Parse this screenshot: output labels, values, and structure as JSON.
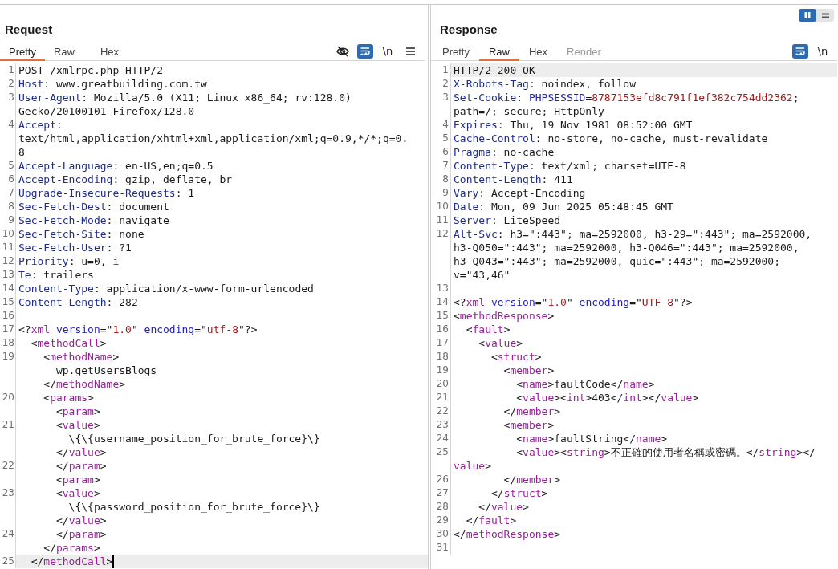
{
  "layout_toggle": [
    {
      "kind": "columns",
      "selected": true
    },
    {
      "kind": "rows",
      "selected": false
    }
  ],
  "request": {
    "title": "Request",
    "caret": true,
    "tabs": [
      {
        "label": "Pretty",
        "selected": true,
        "disabled": false
      },
      {
        "label": "Raw",
        "selected": false,
        "disabled": false
      },
      {
        "label": "Hex",
        "selected": false,
        "disabled": false
      }
    ],
    "toolbar": [
      {
        "kind": "hide",
        "on": false
      },
      {
        "kind": "wrap",
        "on": true
      },
      {
        "kind": "newline",
        "text": "\\n",
        "on": false
      },
      {
        "kind": "menu",
        "on": false
      }
    ],
    "lines": [
      {
        "number": "1",
        "highlighted": false,
        "rows": [
          {
            "tokens": [
              {
                "kind": "plain",
                "text": "POST /xmlrpc.php HTTP/2"
              }
            ]
          }
        ]
      },
      {
        "number": "2",
        "highlighted": false,
        "rows": [
          {
            "tokens": [
              {
                "kind": "header",
                "text": "Host"
              },
              {
                "kind": "plain",
                "text": ": www.greatbuilding.com.tw"
              }
            ]
          }
        ]
      },
      {
        "number": "3",
        "highlighted": false,
        "rows": [
          {
            "tokens": [
              {
                "kind": "header",
                "text": "User-Agent"
              },
              {
                "kind": "plain",
                "text": ": Mozilla/5.0 (X11; Linux x86_64; rv:128.0)"
              }
            ]
          },
          {
            "tokens": [
              {
                "kind": "plain",
                "text": "Gecko/20100101 Firefox/128.0"
              }
            ]
          }
        ]
      },
      {
        "number": "4",
        "highlighted": false,
        "rows": [
          {
            "tokens": [
              {
                "kind": "header",
                "text": "Accept"
              },
              {
                "kind": "plain",
                "text": ":"
              }
            ]
          },
          {
            "tokens": [
              {
                "kind": "plain",
                "text": "text/html,application/xhtml+xml,application/xml;q=0.9,*/*;q=0."
              }
            ]
          },
          {
            "tokens": [
              {
                "kind": "plain",
                "text": "8"
              }
            ]
          }
        ]
      },
      {
        "number": "5",
        "highlighted": false,
        "rows": [
          {
            "tokens": [
              {
                "kind": "header",
                "text": "Accept-Language"
              },
              {
                "kind": "plain",
                "text": ": en-US,en;q=0.5"
              }
            ]
          }
        ]
      },
      {
        "number": "6",
        "highlighted": false,
        "rows": [
          {
            "tokens": [
              {
                "kind": "header",
                "text": "Accept-Encoding"
              },
              {
                "kind": "plain",
                "text": ": gzip, deflate, br"
              }
            ]
          }
        ]
      },
      {
        "number": "7",
        "highlighted": false,
        "rows": [
          {
            "tokens": [
              {
                "kind": "header",
                "text": "Upgrade-Insecure-Requests"
              },
              {
                "kind": "plain",
                "text": ": 1"
              }
            ]
          }
        ]
      },
      {
        "number": "8",
        "highlighted": false,
        "rows": [
          {
            "tokens": [
              {
                "kind": "header",
                "text": "Sec-Fetch-Dest"
              },
              {
                "kind": "plain",
                "text": ": document"
              }
            ]
          }
        ]
      },
      {
        "number": "9",
        "highlighted": false,
        "rows": [
          {
            "tokens": [
              {
                "kind": "header",
                "text": "Sec-Fetch-Mode"
              },
              {
                "kind": "plain",
                "text": ": navigate"
              }
            ]
          }
        ]
      },
      {
        "number": "10",
        "highlighted": false,
        "rows": [
          {
            "tokens": [
              {
                "kind": "header",
                "text": "Sec-Fetch-Site"
              },
              {
                "kind": "plain",
                "text": ": none"
              }
            ]
          }
        ]
      },
      {
        "number": "11",
        "highlighted": false,
        "rows": [
          {
            "tokens": [
              {
                "kind": "header",
                "text": "Sec-Fetch-User"
              },
              {
                "kind": "plain",
                "text": ": ?1"
              }
            ]
          }
        ]
      },
      {
        "number": "12",
        "highlighted": false,
        "rows": [
          {
            "tokens": [
              {
                "kind": "header",
                "text": "Priority"
              },
              {
                "kind": "plain",
                "text": ": u=0, i"
              }
            ]
          }
        ]
      },
      {
        "number": "13",
        "highlighted": false,
        "rows": [
          {
            "tokens": [
              {
                "kind": "header",
                "text": "Te"
              },
              {
                "kind": "plain",
                "text": ": trailers"
              }
            ]
          }
        ]
      },
      {
        "number": "14",
        "highlighted": false,
        "rows": [
          {
            "tokens": [
              {
                "kind": "header",
                "text": "Content-Type"
              },
              {
                "kind": "plain",
                "text": ": application/x-www-form-urlencoded"
              }
            ]
          }
        ]
      },
      {
        "number": "15",
        "highlighted": false,
        "rows": [
          {
            "tokens": [
              {
                "kind": "header",
                "text": "Content-Length"
              },
              {
                "kind": "plain",
                "text": ": 282"
              }
            ]
          }
        ]
      },
      {
        "number": "16",
        "highlighted": false
      },
      {
        "number": "17",
        "highlighted": false,
        "rows": [
          {
            "tokens": [
              {
                "kind": "plain",
                "text": "<?"
              },
              {
                "kind": "tag",
                "text": "xml"
              },
              {
                "kind": "attr",
                "text": " version"
              },
              {
                "kind": "plain",
                "text": "=\""
              },
              {
                "kind": "value",
                "text": "1.0"
              },
              {
                "kind": "plain",
                "text": "\" "
              },
              {
                "kind": "attr",
                "text": "encoding"
              },
              {
                "kind": "plain",
                "text": "=\""
              },
              {
                "kind": "value",
                "text": "utf-8"
              },
              {
                "kind": "plain",
                "text": "\"?>"
              }
            ]
          }
        ]
      },
      {
        "number": "18",
        "highlighted": false,
        "rows": [
          {
            "tokens": [
              {
                "kind": "plain",
                "text": "  <"
              },
              {
                "kind": "tag",
                "text": "methodCall"
              },
              {
                "kind": "plain",
                "text": ">"
              }
            ]
          }
        ]
      },
      {
        "number": "19",
        "highlighted": false,
        "rows": [
          {
            "tokens": [
              {
                "kind": "plain",
                "text": "    <"
              },
              {
                "kind": "tag",
                "text": "methodName"
              },
              {
                "kind": "plain",
                "text": ">"
              }
            ]
          },
          {
            "tokens": [
              {
                "kind": "plain",
                "text": "      wp.getUsersBlogs"
              }
            ]
          },
          {
            "tokens": [
              {
                "kind": "plain",
                "text": "    </"
              },
              {
                "kind": "tag",
                "text": "methodName"
              },
              {
                "kind": "plain",
                "text": ">"
              }
            ]
          }
        ]
      },
      {
        "number": "20",
        "highlighted": false,
        "rows": [
          {
            "tokens": [
              {
                "kind": "plain",
                "text": "    <"
              },
              {
                "kind": "tag",
                "text": "params"
              },
              {
                "kind": "plain",
                "text": ">"
              }
            ]
          },
          {
            "tokens": [
              {
                "kind": "plain",
                "text": "      <"
              },
              {
                "kind": "tag",
                "text": "param"
              },
              {
                "kind": "plain",
                "text": ">"
              }
            ]
          }
        ]
      },
      {
        "number": "21",
        "highlighted": false,
        "rows": [
          {
            "tokens": [
              {
                "kind": "plain",
                "text": "      <"
              },
              {
                "kind": "tag",
                "text": "value"
              },
              {
                "kind": "plain",
                "text": ">"
              }
            ]
          },
          {
            "tokens": [
              {
                "kind": "plain",
                "text": "        \\{\\{username_position_for_brute_force}\\}"
              }
            ]
          },
          {
            "tokens": [
              {
                "kind": "plain",
                "text": "      </"
              },
              {
                "kind": "tag",
                "text": "value"
              },
              {
                "kind": "plain",
                "text": ">"
              }
            ]
          }
        ]
      },
      {
        "number": "22",
        "highlighted": false,
        "rows": [
          {
            "tokens": [
              {
                "kind": "plain",
                "text": "      </"
              },
              {
                "kind": "tag",
                "text": "param"
              },
              {
                "kind": "plain",
                "text": ">"
              }
            ]
          },
          {
            "tokens": [
              {
                "kind": "plain",
                "text": "      <"
              },
              {
                "kind": "tag",
                "text": "param"
              },
              {
                "kind": "plain",
                "text": ">"
              }
            ]
          }
        ]
      },
      {
        "number": "23",
        "highlighted": false,
        "rows": [
          {
            "tokens": [
              {
                "kind": "plain",
                "text": "      <"
              },
              {
                "kind": "tag",
                "text": "value"
              },
              {
                "kind": "plain",
                "text": ">"
              }
            ]
          },
          {
            "tokens": [
              {
                "kind": "plain",
                "text": "        \\{\\{password_position_for_brute_force}\\}"
              }
            ]
          },
          {
            "tokens": [
              {
                "kind": "plain",
                "text": "      </"
              },
              {
                "kind": "tag",
                "text": "value"
              },
              {
                "kind": "plain",
                "text": ">"
              }
            ]
          }
        ]
      },
      {
        "number": "24",
        "highlighted": false,
        "rows": [
          {
            "tokens": [
              {
                "kind": "plain",
                "text": "      </"
              },
              {
                "kind": "tag",
                "text": "param"
              },
              {
                "kind": "plain",
                "text": ">"
              }
            ]
          },
          {
            "tokens": [
              {
                "kind": "plain",
                "text": "    </"
              },
              {
                "kind": "tag",
                "text": "params"
              },
              {
                "kind": "plain",
                "text": ">"
              }
            ]
          }
        ]
      },
      {
        "number": "25",
        "highlighted": true,
        "rows": [
          {
            "tokens": [
              {
                "kind": "plain",
                "text": "  </"
              },
              {
                "kind": "tag",
                "text": "methodCall"
              },
              {
                "kind": "plain",
                "text": ">"
              }
            ]
          }
        ]
      }
    ]
  },
  "response": {
    "title": "Response",
    "tabs": [
      {
        "label": "Pretty",
        "selected": false,
        "disabled": false
      },
      {
        "label": "Raw",
        "selected": true,
        "disabled": false
      },
      {
        "label": "Hex",
        "selected": false,
        "disabled": false
      },
      {
        "label": "Render",
        "selected": false,
        "disabled": true
      }
    ],
    "toolbar": [
      {
        "kind": "wrap",
        "on": true
      },
      {
        "kind": "newline",
        "text": "\\n",
        "on": false
      }
    ],
    "lines": [
      {
        "number": "1",
        "highlighted": true,
        "rows": [
          {
            "tokens": [
              {
                "kind": "plain",
                "text": "HTTP/2 200 OK"
              }
            ]
          }
        ]
      },
      {
        "number": "2",
        "highlighted": false,
        "rows": [
          {
            "tokens": [
              {
                "kind": "header",
                "text": "X-Robots-Tag"
              },
              {
                "kind": "plain",
                "text": ": noindex, follow"
              }
            ]
          }
        ]
      },
      {
        "number": "3",
        "highlighted": false,
        "rows": [
          {
            "tokens": [
              {
                "kind": "header",
                "text": "Set-Cookie"
              },
              {
                "kind": "plain",
                "text": ": "
              },
              {
                "kind": "attr",
                "text": "PHPSESSID"
              },
              {
                "kind": "plain",
                "text": "="
              },
              {
                "kind": "value",
                "text": "8787153efd8c791f1ef382c754dd2362"
              },
              {
                "kind": "plain",
                "text": ";"
              }
            ]
          },
          {
            "tokens": [
              {
                "kind": "plain",
                "text": "path=/; secure; HttpOnly"
              }
            ]
          }
        ]
      },
      {
        "number": "4",
        "highlighted": false,
        "rows": [
          {
            "tokens": [
              {
                "kind": "header",
                "text": "Expires"
              },
              {
                "kind": "plain",
                "text": ": Thu, 19 Nov 1981 08:52:00 GMT"
              }
            ]
          }
        ]
      },
      {
        "number": "5",
        "highlighted": false,
        "rows": [
          {
            "tokens": [
              {
                "kind": "header",
                "text": "Cache-Control"
              },
              {
                "kind": "plain",
                "text": ": no-store, no-cache, must-revalidate"
              }
            ]
          }
        ]
      },
      {
        "number": "6",
        "highlighted": false,
        "rows": [
          {
            "tokens": [
              {
                "kind": "header",
                "text": "Pragma"
              },
              {
                "kind": "plain",
                "text": ": no-cache"
              }
            ]
          }
        ]
      },
      {
        "number": "7",
        "highlighted": false,
        "rows": [
          {
            "tokens": [
              {
                "kind": "header",
                "text": "Content-Type"
              },
              {
                "kind": "plain",
                "text": ": text/xml; charset=UTF-8"
              }
            ]
          }
        ]
      },
      {
        "number": "8",
        "highlighted": false,
        "rows": [
          {
            "tokens": [
              {
                "kind": "header",
                "text": "Content-Length"
              },
              {
                "kind": "plain",
                "text": ": 411"
              }
            ]
          }
        ]
      },
      {
        "number": "9",
        "highlighted": false,
        "rows": [
          {
            "tokens": [
              {
                "kind": "header",
                "text": "Vary"
              },
              {
                "kind": "plain",
                "text": ": Accept-Encoding"
              }
            ]
          }
        ]
      },
      {
        "number": "10",
        "highlighted": false,
        "rows": [
          {
            "tokens": [
              {
                "kind": "header",
                "text": "Date"
              },
              {
                "kind": "plain",
                "text": ": Mon, 09 Jun 2025 05:48:45 GMT"
              }
            ]
          }
        ]
      },
      {
        "number": "11",
        "highlighted": false,
        "rows": [
          {
            "tokens": [
              {
                "kind": "header",
                "text": "Server"
              },
              {
                "kind": "plain",
                "text": ": LiteSpeed"
              }
            ]
          }
        ]
      },
      {
        "number": "12",
        "highlighted": false,
        "rows": [
          {
            "tokens": [
              {
                "kind": "header",
                "text": "Alt-Svc"
              },
              {
                "kind": "plain",
                "text": ": h3=\":443\"; ma=2592000, h3-29=\":443\"; ma=2592000,"
              }
            ]
          },
          {
            "tokens": [
              {
                "kind": "plain",
                "text": "h3-Q050=\":443\"; ma=2592000, h3-Q046=\":443\"; ma=2592000,"
              }
            ]
          },
          {
            "tokens": [
              {
                "kind": "plain",
                "text": "h3-Q043=\":443\"; ma=2592000, quic=\":443\"; ma=2592000;"
              }
            ]
          },
          {
            "tokens": [
              {
                "kind": "plain",
                "text": "v=\"43,46\""
              }
            ]
          }
        ]
      },
      {
        "number": "13",
        "highlighted": false
      },
      {
        "number": "14",
        "highlighted": false,
        "rows": [
          {
            "tokens": [
              {
                "kind": "plain",
                "text": "<?"
              },
              {
                "kind": "tag",
                "text": "xml"
              },
              {
                "kind": "attr",
                "text": " version"
              },
              {
                "kind": "plain",
                "text": "=\""
              },
              {
                "kind": "value",
                "text": "1.0"
              },
              {
                "kind": "plain",
                "text": "\" "
              },
              {
                "kind": "attr",
                "text": "encoding"
              },
              {
                "kind": "plain",
                "text": "=\""
              },
              {
                "kind": "value",
                "text": "UTF-8"
              },
              {
                "kind": "plain",
                "text": "\"?>"
              }
            ]
          }
        ]
      },
      {
        "number": "15",
        "highlighted": false,
        "rows": [
          {
            "tokens": [
              {
                "kind": "plain",
                "text": "<"
              },
              {
                "kind": "tag",
                "text": "methodResponse"
              },
              {
                "kind": "plain",
                "text": ">"
              }
            ]
          }
        ]
      },
      {
        "number": "16",
        "highlighted": false,
        "rows": [
          {
            "tokens": [
              {
                "kind": "plain",
                "text": "  <"
              },
              {
                "kind": "tag",
                "text": "fault"
              },
              {
                "kind": "plain",
                "text": ">"
              }
            ]
          }
        ]
      },
      {
        "number": "17",
        "highlighted": false,
        "rows": [
          {
            "tokens": [
              {
                "kind": "plain",
                "text": "    <"
              },
              {
                "kind": "tag",
                "text": "value"
              },
              {
                "kind": "plain",
                "text": ">"
              }
            ]
          }
        ]
      },
      {
        "number": "18",
        "highlighted": false,
        "rows": [
          {
            "tokens": [
              {
                "kind": "plain",
                "text": "      <"
              },
              {
                "kind": "tag",
                "text": "struct"
              },
              {
                "kind": "plain",
                "text": ">"
              }
            ]
          }
        ]
      },
      {
        "number": "19",
        "highlighted": false,
        "rows": [
          {
            "tokens": [
              {
                "kind": "plain",
                "text": "        <"
              },
              {
                "kind": "tag",
                "text": "member"
              },
              {
                "kind": "plain",
                "text": ">"
              }
            ]
          }
        ]
      },
      {
        "number": "20",
        "highlighted": false,
        "rows": [
          {
            "tokens": [
              {
                "kind": "plain",
                "text": "          <"
              },
              {
                "kind": "tag",
                "text": "name"
              },
              {
                "kind": "plain",
                "text": ">faultCode</"
              },
              {
                "kind": "tag",
                "text": "name"
              },
              {
                "kind": "plain",
                "text": ">"
              }
            ]
          }
        ]
      },
      {
        "number": "21",
        "highlighted": false,
        "rows": [
          {
            "tokens": [
              {
                "kind": "plain",
                "text": "          <"
              },
              {
                "kind": "tag",
                "text": "value"
              },
              {
                "kind": "plain",
                "text": "><"
              },
              {
                "kind": "tag",
                "text": "int"
              },
              {
                "kind": "plain",
                "text": ">403</"
              },
              {
                "kind": "tag",
                "text": "int"
              },
              {
                "kind": "plain",
                "text": "></"
              },
              {
                "kind": "tag",
                "text": "value"
              },
              {
                "kind": "plain",
                "text": ">"
              }
            ]
          }
        ]
      },
      {
        "number": "22",
        "highlighted": false,
        "rows": [
          {
            "tokens": [
              {
                "kind": "plain",
                "text": "        </"
              },
              {
                "kind": "tag",
                "text": "member"
              },
              {
                "kind": "plain",
                "text": ">"
              }
            ]
          }
        ]
      },
      {
        "number": "23",
        "highlighted": false,
        "rows": [
          {
            "tokens": [
              {
                "kind": "plain",
                "text": "        <"
              },
              {
                "kind": "tag",
                "text": "member"
              },
              {
                "kind": "plain",
                "text": ">"
              }
            ]
          }
        ]
      },
      {
        "number": "24",
        "highlighted": false,
        "rows": [
          {
            "tokens": [
              {
                "kind": "plain",
                "text": "          <"
              },
              {
                "kind": "tag",
                "text": "name"
              },
              {
                "kind": "plain",
                "text": ">faultString</"
              },
              {
                "kind": "tag",
                "text": "name"
              },
              {
                "kind": "plain",
                "text": ">"
              }
            ]
          }
        ]
      },
      {
        "number": "25",
        "highlighted": false,
        "rows": [
          {
            "tokens": [
              {
                "kind": "plain",
                "text": "          <"
              },
              {
                "kind": "tag",
                "text": "value"
              },
              {
                "kind": "plain",
                "text": "><"
              },
              {
                "kind": "tag",
                "text": "string"
              },
              {
                "kind": "plain",
                "text": ">不正確的使用者名稱或密碼。</"
              },
              {
                "kind": "tag",
                "text": "string"
              },
              {
                "kind": "plain",
                "text": "></"
              }
            ]
          },
          {
            "tokens": [
              {
                "kind": "tag",
                "text": "value"
              },
              {
                "kind": "plain",
                "text": ">"
              }
            ]
          }
        ]
      },
      {
        "number": "26",
        "highlighted": false,
        "rows": [
          {
            "tokens": [
              {
                "kind": "plain",
                "text": "        </"
              },
              {
                "kind": "tag",
                "text": "member"
              },
              {
                "kind": "plain",
                "text": ">"
              }
            ]
          }
        ]
      },
      {
        "number": "27",
        "highlighted": false,
        "rows": [
          {
            "tokens": [
              {
                "kind": "plain",
                "text": "      </"
              },
              {
                "kind": "tag",
                "text": "struct"
              },
              {
                "kind": "plain",
                "text": ">"
              }
            ]
          }
        ]
      },
      {
        "number": "28",
        "highlighted": false,
        "rows": [
          {
            "tokens": [
              {
                "kind": "plain",
                "text": "    </"
              },
              {
                "kind": "tag",
                "text": "value"
              },
              {
                "kind": "plain",
                "text": ">"
              }
            ]
          }
        ]
      },
      {
        "number": "29",
        "highlighted": false,
        "rows": [
          {
            "tokens": [
              {
                "kind": "plain",
                "text": "  </"
              },
              {
                "kind": "tag",
                "text": "fault"
              },
              {
                "kind": "plain",
                "text": ">"
              }
            ]
          }
        ]
      },
      {
        "number": "30",
        "highlighted": false,
        "rows": [
          {
            "tokens": [
              {
                "kind": "plain",
                "text": "</"
              },
              {
                "kind": "tag",
                "text": "methodResponse"
              },
              {
                "kind": "plain",
                "text": ">"
              }
            ]
          }
        ]
      },
      {
        "number": "31",
        "highlighted": false
      }
    ]
  }
}
